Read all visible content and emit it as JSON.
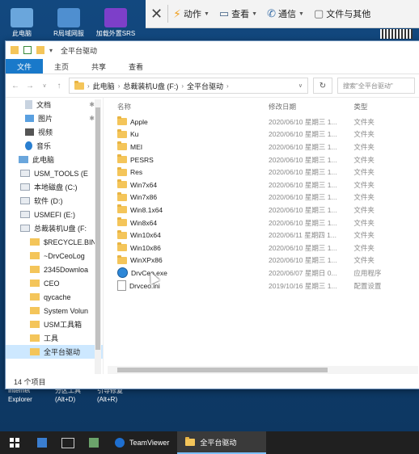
{
  "desktop": {
    "icons": [
      {
        "label": "此电脑",
        "x_note": "left"
      },
      {
        "label": "R局域网服",
        "x_note": "mid"
      },
      {
        "label": "加载外置SRS",
        "x_note": "right"
      }
    ],
    "bottom_left": [
      "Internet",
      "Explorer"
    ],
    "bottom_mid": [
      "分区工具",
      "(Alt+D)"
    ],
    "bottom_right": [
      "引导修复",
      "(Alt+R)"
    ]
  },
  "remote_toolbar": {
    "action": "动作",
    "view": "查看",
    "comm": "通信",
    "files": "文件与其他"
  },
  "window": {
    "title": "全平台驱动",
    "ribbon_tabs": [
      "文件",
      "主页",
      "共享",
      "查看"
    ],
    "address": [
      "此电脑",
      "总裁装机U盘 (F:)",
      "全平台驱动"
    ],
    "search_placeholder": "搜索\"全平台驱动\"",
    "nav_items": [
      {
        "label": "文档",
        "pinned": true,
        "icon": "document-icon"
      },
      {
        "label": "图片",
        "pinned": true,
        "icon": "picture-icon"
      },
      {
        "label": "视频",
        "pinned": false,
        "icon": "video-icon"
      },
      {
        "label": "音乐",
        "pinned": false,
        "icon": "music-icon"
      },
      {
        "label": "此电脑",
        "pinned": false,
        "icon": "computer-icon"
      },
      {
        "label": "USM_TOOLS (E",
        "pinned": false,
        "icon": "drive-icon"
      },
      {
        "label": "本地磁盘 (C:)",
        "pinned": false,
        "icon": "drive-icon"
      },
      {
        "label": "软件 (D:)",
        "pinned": false,
        "icon": "drive-icon"
      },
      {
        "label": "USMEFI (E:)",
        "pinned": false,
        "icon": "drive-icon"
      },
      {
        "label": "总裁装机U盘 (F:",
        "pinned": false,
        "icon": "usb-drive-icon"
      },
      {
        "label": "$RECYCLE.BIN",
        "pinned": false,
        "icon": "folder-icon"
      },
      {
        "label": "~DrvCeoLog",
        "pinned": false,
        "icon": "folder-icon"
      },
      {
        "label": "2345Downloa",
        "pinned": false,
        "icon": "folder-icon"
      },
      {
        "label": "CEO",
        "pinned": false,
        "icon": "folder-icon"
      },
      {
        "label": "qycache",
        "pinned": false,
        "icon": "folder-icon"
      },
      {
        "label": "System Volun",
        "pinned": false,
        "icon": "folder-icon"
      },
      {
        "label": "USM工具箱",
        "pinned": false,
        "icon": "folder-icon"
      },
      {
        "label": "工具",
        "pinned": false,
        "icon": "folder-icon"
      },
      {
        "label": "全平台驱动",
        "pinned": false,
        "icon": "folder-icon",
        "selected": true
      }
    ],
    "columns": [
      "名称",
      "修改日期",
      "类型"
    ],
    "files": [
      {
        "name": "Apple",
        "date": "2020/06/10 星期三 1...",
        "type": "文件夹",
        "kind": "folder"
      },
      {
        "name": "Ku",
        "date": "2020/06/10 星期三 1...",
        "type": "文件夹",
        "kind": "folder"
      },
      {
        "name": "MEI",
        "date": "2020/06/10 星期三 1...",
        "type": "文件夹",
        "kind": "folder"
      },
      {
        "name": "PESRS",
        "date": "2020/06/10 星期三 1...",
        "type": "文件夹",
        "kind": "folder"
      },
      {
        "name": "Res",
        "date": "2020/06/10 星期三 1...",
        "type": "文件夹",
        "kind": "folder"
      },
      {
        "name": "Win7x64",
        "date": "2020/06/10 星期三 1...",
        "type": "文件夹",
        "kind": "folder"
      },
      {
        "name": "Win7x86",
        "date": "2020/06/10 星期三 1...",
        "type": "文件夹",
        "kind": "folder"
      },
      {
        "name": "Win8.1x64",
        "date": "2020/06/10 星期三 1...",
        "type": "文件夹",
        "kind": "folder"
      },
      {
        "name": "Win8x64",
        "date": "2020/06/10 星期三 1...",
        "type": "文件夹",
        "kind": "folder"
      },
      {
        "name": "Win10x64",
        "date": "2020/06/11 星期四 1...",
        "type": "文件夹",
        "kind": "folder"
      },
      {
        "name": "Win10x86",
        "date": "2020/06/10 星期三 1...",
        "type": "文件夹",
        "kind": "folder"
      },
      {
        "name": "WinXPx86",
        "date": "2020/06/10 星期三 1...",
        "type": "文件夹",
        "kind": "folder"
      },
      {
        "name": "DrvCeo.exe",
        "date": "2020/06/07 星期日 0...",
        "type": "应用程序",
        "kind": "app"
      },
      {
        "name": "Drvceo.ini",
        "date": "2019/10/16 星期三 1...",
        "type": "配置设置",
        "kind": "ini"
      }
    ],
    "status": "14 个项目"
  },
  "taskbar": {
    "teamviewer": "TeamViewer",
    "explorer": "全平台驱动"
  }
}
